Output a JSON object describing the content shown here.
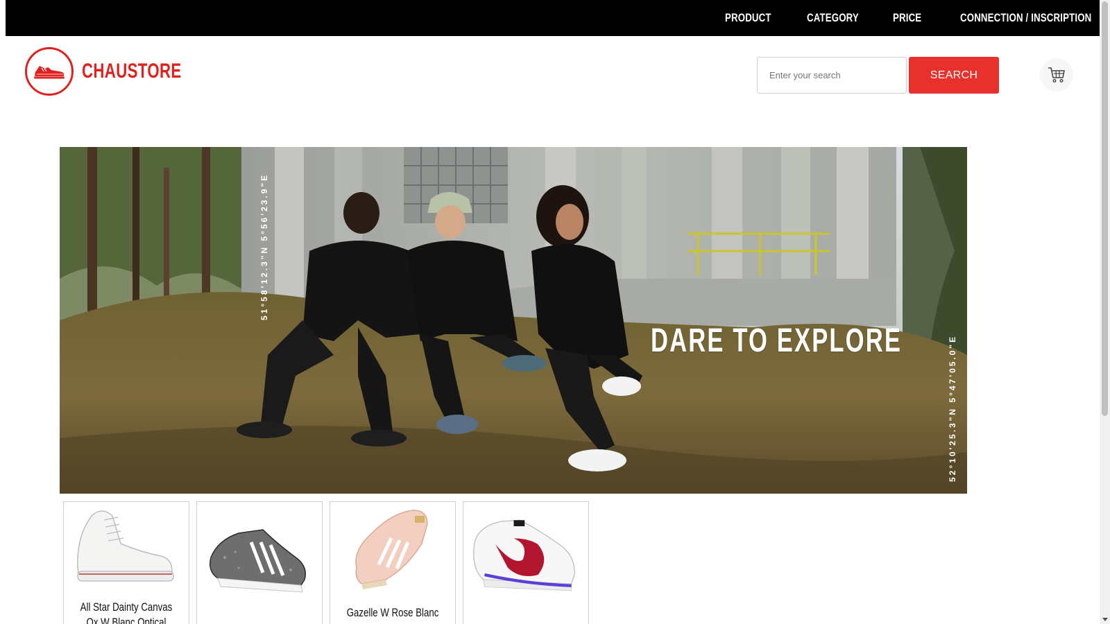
{
  "nav": {
    "items": [
      "PRODUCT",
      "CATEGORY",
      "PRICE",
      "CONNECTION / INSCRIPTION"
    ]
  },
  "header": {
    "brand": "CHAUSTORE",
    "brand_color": "#e0221f",
    "search_placeholder": "Enter your search",
    "search_button": "SEARCH",
    "cart_icon": "cart-icon"
  },
  "hero": {
    "title": "DARE TO EXPLORE",
    "coord_left": "51°58'12.3\"N 5°56'23.9\"E",
    "coord_right": "52°10'25.3\"N 5°47'05.0\"E"
  },
  "products": [
    {
      "name": "All Star Dainty Canvas Ox W Blanc Optical"
    },
    {
      "name": ""
    },
    {
      "name": "Gazelle W Rose Blanc"
    },
    {
      "name": ""
    }
  ]
}
